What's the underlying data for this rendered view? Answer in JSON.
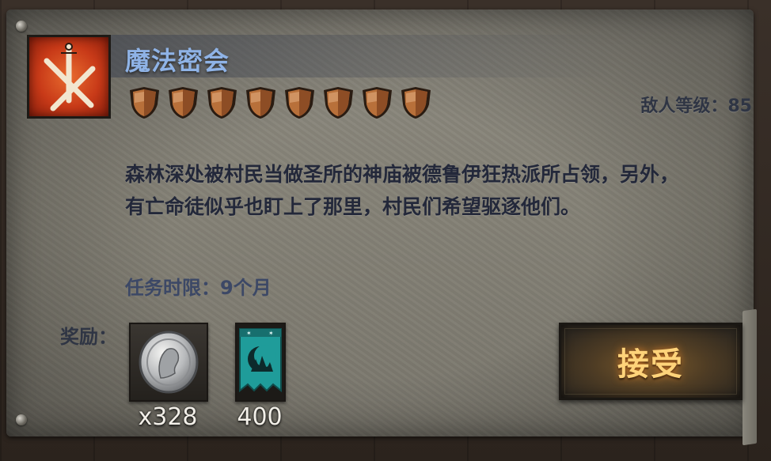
{
  "mission": {
    "title": "魔法密会",
    "icon": "crossed-swords-icon",
    "difficulty_shields": 8,
    "enemy_level_text": "敌人等级：85",
    "description_lines": [
      "森林深处被村民当做圣所的神庙被德鲁伊狂热派所占领，另外，",
      "有亡命徒似乎也盯上了那里，村民们希望驱逐他们。"
    ],
    "time_limit_text": "任务时限：9个月"
  },
  "rewards": {
    "label": "奖励：",
    "items": [
      {
        "icon": "silver-coin-icon",
        "count": "x328"
      },
      {
        "icon": "moon-banner-icon",
        "count": "400"
      }
    ]
  },
  "actions": {
    "accept_label": "接受"
  },
  "colors": {
    "title": "#8fb3e6",
    "accept_text": "#ffd37a",
    "shield": "#b8703a",
    "banner": "#1f9c9a"
  }
}
